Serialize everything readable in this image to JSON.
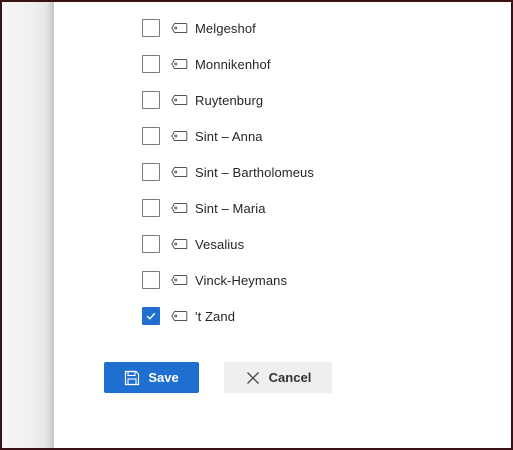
{
  "items": [
    {
      "label": "Melgeshof",
      "checked": false
    },
    {
      "label": "Monnikenhof",
      "checked": false
    },
    {
      "label": "Ruytenburg",
      "checked": false
    },
    {
      "label": "Sint – Anna",
      "checked": false
    },
    {
      "label": "Sint – Bartholomeus",
      "checked": false
    },
    {
      "label": "Sint – Maria",
      "checked": false
    },
    {
      "label": "Vesalius",
      "checked": false
    },
    {
      "label": "Vinck-Heymans",
      "checked": false
    },
    {
      "label": "'t Zand",
      "checked": true
    }
  ],
  "actions": {
    "save_label": "Save",
    "cancel_label": "Cancel"
  },
  "icons": {
    "item_icon": "tag-icon",
    "save_icon": "floppy-disk-icon",
    "cancel_icon": "close-icon",
    "check_icon": "checkmark-icon"
  },
  "colors": {
    "accent": "#1f6fd0",
    "cancel_bg": "#efefef",
    "frame_border": "#3a1216"
  }
}
